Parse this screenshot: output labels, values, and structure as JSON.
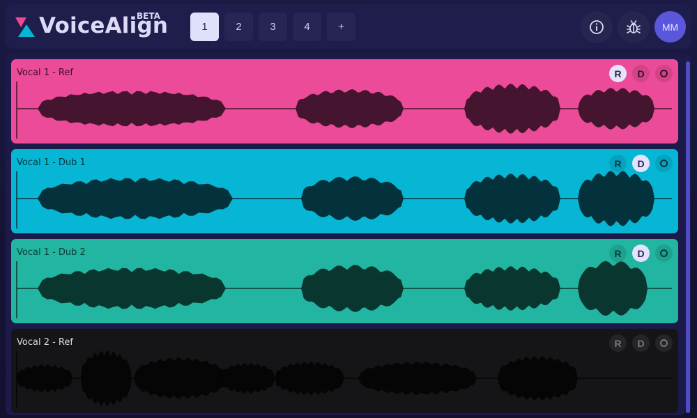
{
  "app": {
    "title": "VoiceAlign",
    "badge": "BETA"
  },
  "header": {
    "tabs": [
      {
        "label": "1",
        "active": true
      },
      {
        "label": "2",
        "active": false
      },
      {
        "label": "3",
        "active": false
      },
      {
        "label": "4",
        "active": false
      },
      {
        "label": "+",
        "active": false
      }
    ],
    "icons": [
      "info-icon",
      "bug-icon"
    ],
    "avatar_initials": "MM"
  },
  "tracks": [
    {
      "name": "Vocal 1 - Ref",
      "bg": "#eb4b98",
      "wave": "#45142e",
      "label_color": "#3a0f27",
      "buttons": [
        "R",
        "D",
        "O"
      ],
      "active": "R"
    },
    {
      "name": "Vocal 1 - Dub 1",
      "bg": "#06b6d4",
      "wave": "#04323c",
      "label_color": "#053741",
      "buttons": [
        "R",
        "D",
        "O"
      ],
      "active": "D"
    },
    {
      "name": "Vocal 1 - Dub 2",
      "bg": "#22b5a1",
      "wave": "#0a3630",
      "label_color": "#0b3b34",
      "buttons": [
        "R",
        "D",
        "O"
      ],
      "active": "D"
    },
    {
      "name": "Vocal 2 - Ref",
      "bg": "#151517",
      "wave": "#050506",
      "label_color": "#d8d8e2",
      "buttons": [
        "R",
        "D",
        "O"
      ],
      "active": ""
    }
  ]
}
